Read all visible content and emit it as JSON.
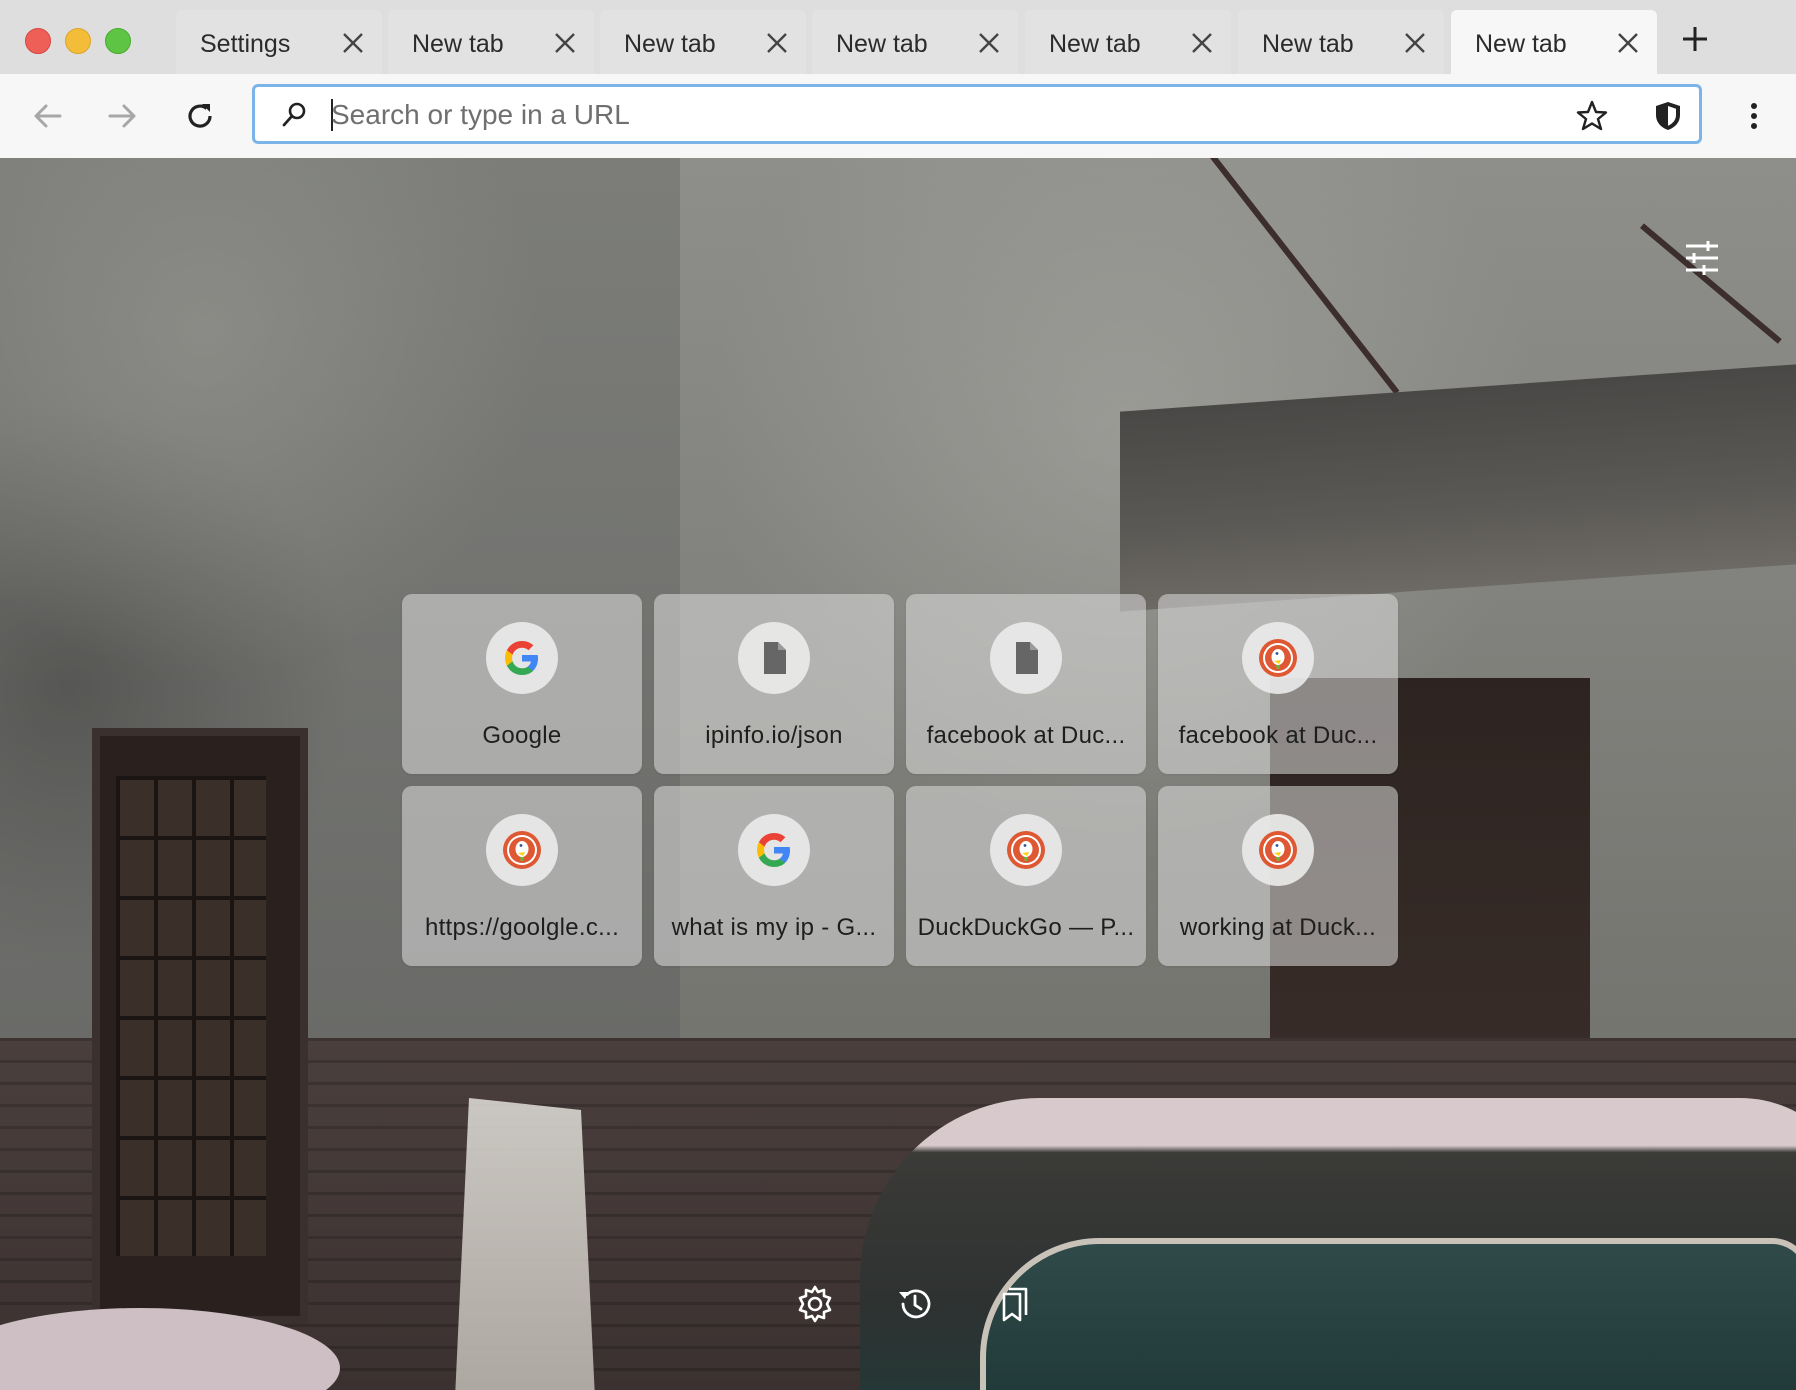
{
  "window_controls": {
    "close": "close",
    "minimize": "minimize",
    "zoom": "zoom"
  },
  "tabs": [
    {
      "label": "Settings",
      "active": false
    },
    {
      "label": "New tab",
      "active": false
    },
    {
      "label": "New tab",
      "active": false
    },
    {
      "label": "New tab",
      "active": false
    },
    {
      "label": "New tab",
      "active": false
    },
    {
      "label": "New tab",
      "active": false
    },
    {
      "label": "New tab",
      "active": true
    }
  ],
  "toolbar": {
    "back_icon": "arrow-left-icon",
    "forward_icon": "arrow-right-icon",
    "reload_icon": "reload-icon",
    "menu_icon": "kebab-menu-icon"
  },
  "omnibox": {
    "value": "",
    "placeholder": "Search or type in a URL",
    "search_icon": "search-icon",
    "bookmark_icon": "star-icon",
    "shield_icon": "shield-icon"
  },
  "top_sites": [
    {
      "title": "Google",
      "icon": "google-icon"
    },
    {
      "title": "ipinfo.io/json",
      "icon": "document-icon"
    },
    {
      "title": "facebook at Duc...",
      "icon": "document-icon"
    },
    {
      "title": "facebook at Duc...",
      "icon": "duckduckgo-icon"
    },
    {
      "title": "https://goolgle.c...",
      "icon": "duckduckgo-icon"
    },
    {
      "title": "what is my ip - G...",
      "icon": "google-icon"
    },
    {
      "title": "DuckDuckGo — P...",
      "icon": "duckduckgo-icon"
    },
    {
      "title": "working at Duck...",
      "icon": "duckduckgo-icon"
    }
  ],
  "bottom_controls": {
    "settings_icon": "gear-icon",
    "history_icon": "history-icon",
    "bookmarks_icon": "bookmarks-icon"
  },
  "colors": {
    "omnibox_focus_border": "#7ab4e8",
    "duckduckgo_orange": "#de5833",
    "google_blue": "#4285f4",
    "google_red": "#ea4335",
    "google_yellow": "#fbbc05",
    "google_green": "#34a853"
  }
}
